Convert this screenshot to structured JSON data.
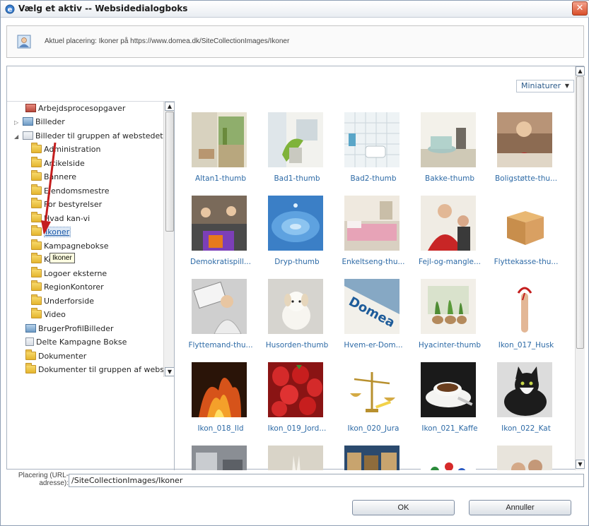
{
  "window": {
    "title": "Vælg et aktiv -- Websidedialogboks",
    "close_glyph": "✕"
  },
  "location": {
    "text": "Aktuel placering: Ikoner på https://www.domea.dk/SiteCollectionImages/Ikoner",
    "icon": "image-folder-icon"
  },
  "view": {
    "label": "Miniaturer",
    "caret": "▼"
  },
  "tree": {
    "items": [
      {
        "label": "Arbejdsprocesopgaver",
        "icon": "tasks-icon"
      },
      {
        "label": "Billeder",
        "icon": "picture-library-icon",
        "expander": "▷"
      },
      {
        "label": "Billeder til gruppen af webstedet",
        "icon": "document-library-icon",
        "expander": "◢"
      },
      {
        "label": "Administration",
        "icon": "folder-icon"
      },
      {
        "label": "Artikelside",
        "icon": "folder-icon"
      },
      {
        "label": "Bannere",
        "icon": "folder-icon"
      },
      {
        "label": "Ejendomsmestre",
        "icon": "folder-icon"
      },
      {
        "label": "For bestyrelser",
        "icon": "folder-icon"
      },
      {
        "label": "Hvad kan-vi",
        "icon": "folder-icon"
      },
      {
        "label": "Ikoner",
        "icon": "folder-open-icon",
        "selected": true
      },
      {
        "label": "Kampagnebokse",
        "icon": "folder-icon"
      },
      {
        "label": "Kontakt",
        "icon": "folder-icon"
      },
      {
        "label": "Logoer eksterne",
        "icon": "folder-icon"
      },
      {
        "label": "RegionKontorer",
        "icon": "folder-icon"
      },
      {
        "label": "Underforside",
        "icon": "folder-icon"
      },
      {
        "label": "Video",
        "icon": "folder-icon"
      },
      {
        "label": "BrugerProfilBilleder",
        "icon": "picture-library-icon"
      },
      {
        "label": "Delte Kampagne Bokse",
        "icon": "document-icon"
      },
      {
        "label": "Dokumenter",
        "icon": "document-library-icon"
      },
      {
        "label": "Dokumenter til gruppen af webstedet",
        "icon": "document-library-icon"
      }
    ],
    "tooltip": "Ikoner"
  },
  "thumbnails": [
    {
      "caption": "Altan1-thumb"
    },
    {
      "caption": "Bad1-thumb"
    },
    {
      "caption": "Bad2-thumb"
    },
    {
      "caption": "Bakke-thumb"
    },
    {
      "caption": "Boligstøtte-thu..."
    },
    {
      "caption": "Demokratispill..."
    },
    {
      "caption": "Dryp-thumb"
    },
    {
      "caption": "Enkeltseng-thu..."
    },
    {
      "caption": "Fejl-og-mangle..."
    },
    {
      "caption": "Flyttekasse-thu..."
    },
    {
      "caption": "Flyttemand-thu..."
    },
    {
      "caption": "Husorden-thumb"
    },
    {
      "caption": "Hvem-er-Dom..."
    },
    {
      "caption": "Hyacinter-thumb"
    },
    {
      "caption": "Ikon_017_Husk"
    },
    {
      "caption": "Ikon_018_Ild"
    },
    {
      "caption": "Ikon_019_Jord..."
    },
    {
      "caption": "Ikon_020_Jura"
    },
    {
      "caption": "Ikon_021_Kaffe"
    },
    {
      "caption": "Ikon_022_Kat"
    }
  ],
  "url_row": {
    "label": "Placering (URL-adresse):",
    "value": "/SiteCollectionImages/Ikoner"
  },
  "buttons": {
    "ok": "OK",
    "cancel": "Annuller"
  },
  "colors": {
    "link_blue": "#2d6aa6",
    "annotation_red": "#c41e1e"
  }
}
